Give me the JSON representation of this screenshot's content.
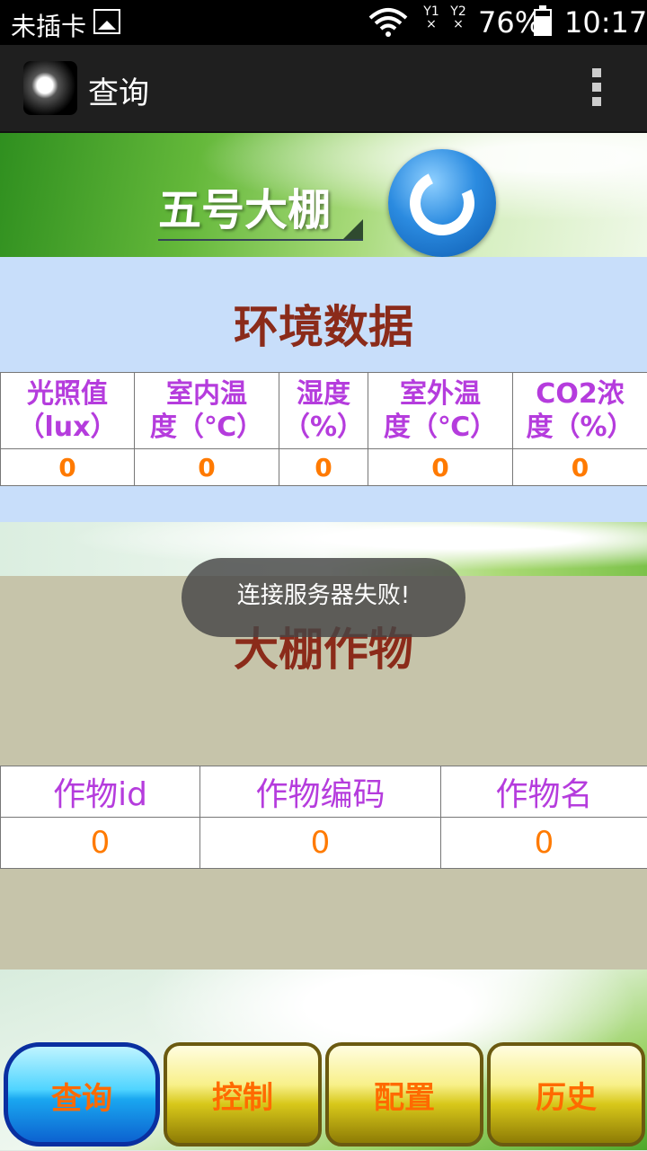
{
  "status_bar": {
    "carrier": "未插卡",
    "sim1": "Y1",
    "sim2": "Y2",
    "battery": "76%",
    "time": "10:17"
  },
  "action_bar": {
    "title": "查询"
  },
  "banner": {
    "greenhouse_name": "五号大棚"
  },
  "environment": {
    "heading": "环境数据",
    "headers": [
      [
        "光照值",
        "（lux）"
      ],
      [
        "室内温",
        "度（℃）"
      ],
      [
        "湿度",
        "（%）"
      ],
      [
        "室外温",
        "度（℃）"
      ],
      [
        "CO2浓",
        "度（%）"
      ]
    ],
    "values": [
      "0",
      "0",
      "0",
      "0",
      "0"
    ]
  },
  "crops": {
    "heading": "大棚作物",
    "headers": [
      "作物id",
      "作物编码",
      "作物名"
    ],
    "values": [
      "0",
      "0",
      "0"
    ]
  },
  "toast": "连接服务器失败!",
  "nav": {
    "query": "查询",
    "control": "控制",
    "config": "配置",
    "history": "历史"
  },
  "colors": {
    "header_text": "#b53cdd",
    "value_text": "#ff7a00",
    "heading_text": "#8b2b1a"
  }
}
